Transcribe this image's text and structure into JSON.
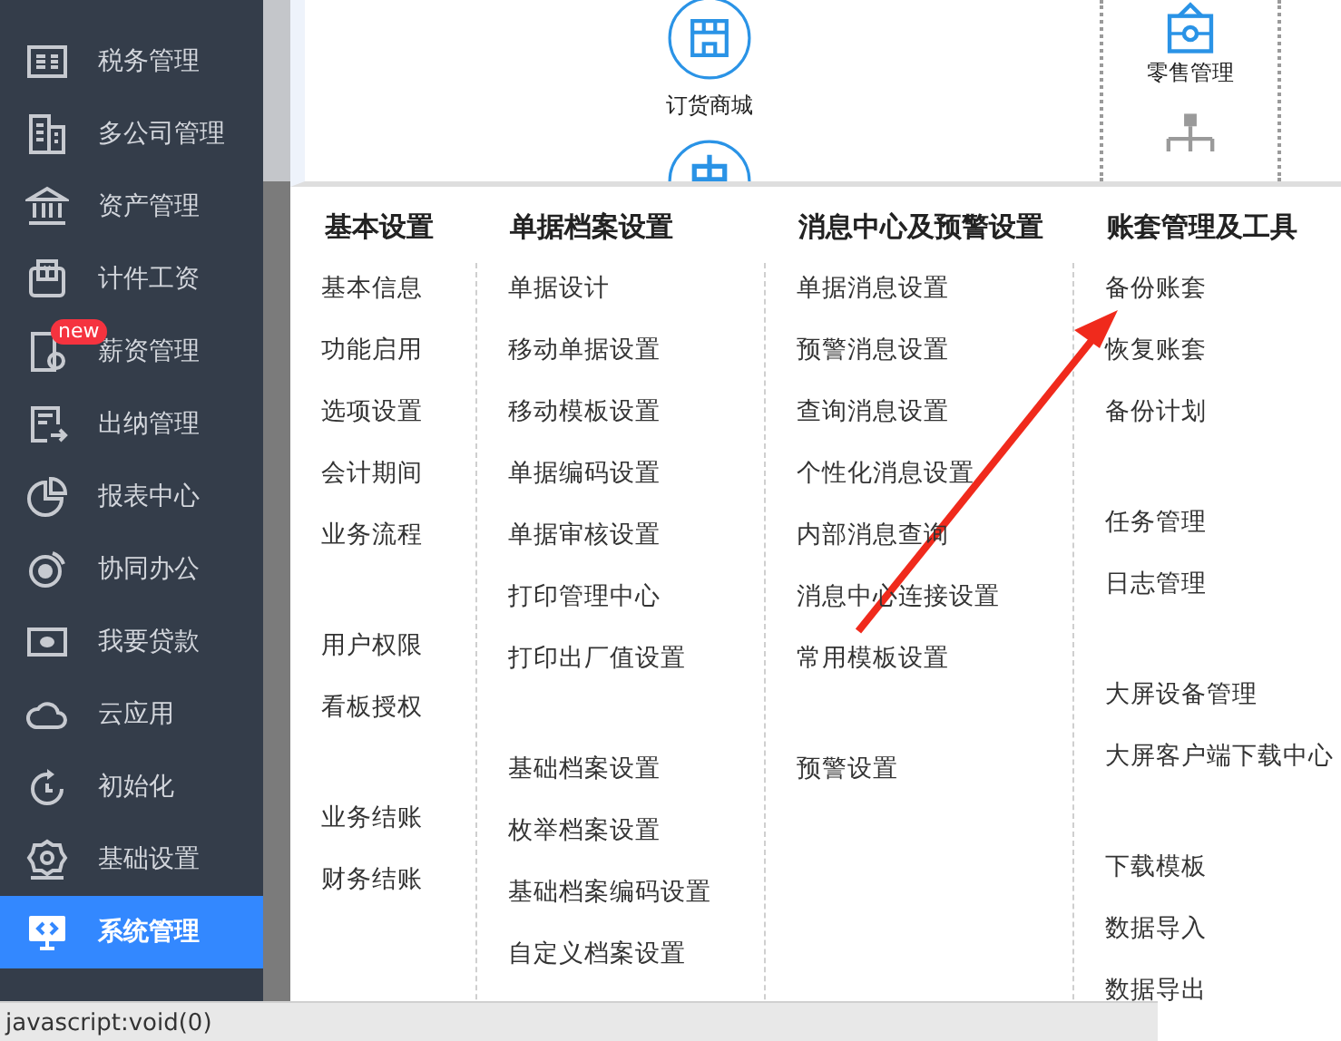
{
  "sidebar": {
    "items": [
      {
        "label": "税务管理",
        "selected": false
      },
      {
        "label": "多公司管理",
        "selected": false
      },
      {
        "label": "资产管理",
        "selected": false
      },
      {
        "label": "计件工资",
        "selected": false
      },
      {
        "label": "薪资管理",
        "selected": false,
        "badge": "new"
      },
      {
        "label": "出纳管理",
        "selected": false
      },
      {
        "label": "报表中心",
        "selected": false
      },
      {
        "label": "协同办公",
        "selected": false
      },
      {
        "label": "我要贷款",
        "selected": false
      },
      {
        "label": "云应用",
        "selected": false
      },
      {
        "label": "初始化",
        "selected": false
      },
      {
        "label": "基础设置",
        "selected": false
      },
      {
        "label": "系统管理",
        "selected": true
      }
    ]
  },
  "top_cards": [
    {
      "label": "订货商城"
    },
    {
      "label": "零售管理"
    }
  ],
  "menu": {
    "columns": [
      {
        "title": "基本设置",
        "groups": [
          [
            "基本信息",
            "功能启用",
            "选项设置",
            "会计期间",
            "业务流程"
          ],
          [
            "用户权限",
            "看板授权"
          ],
          [
            "业务结账",
            "财务结账"
          ]
        ]
      },
      {
        "title": "单据档案设置",
        "groups": [
          [
            "单据设计",
            "移动单据设置",
            "移动模板设置",
            "单据编码设置",
            "单据审核设置",
            "打印管理中心",
            "打印出厂值设置"
          ],
          [
            "基础档案设置",
            "枚举档案设置",
            "基础档案编码设置",
            "自定义档案设置"
          ]
        ]
      },
      {
        "title": "消息中心及预警设置",
        "groups": [
          [
            "单据消息设置",
            "预警消息设置",
            "查询消息设置",
            "个性化消息设置",
            "内部消息查询",
            "消息中心连接设置",
            "常用模板设置"
          ],
          [
            "预警设置"
          ]
        ]
      },
      {
        "title": "账套管理及工具",
        "groups": [
          [
            "备份账套",
            "恢复账套",
            "备份计划"
          ],
          [
            "任务管理",
            "日志管理"
          ],
          [
            "大屏设备管理",
            "大屏客户端下载中心"
          ],
          [
            "下载模板",
            "数据导入",
            "数据导出"
          ]
        ]
      }
    ]
  },
  "status_bar": "javascript:void(0)"
}
